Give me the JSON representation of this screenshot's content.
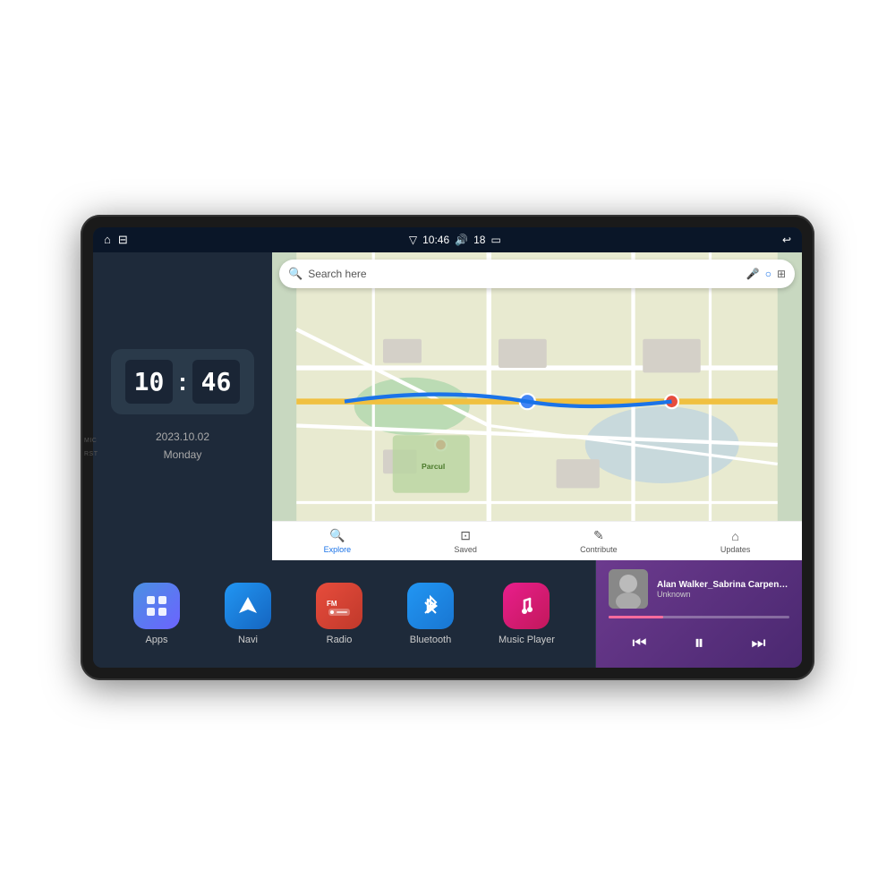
{
  "device": {
    "side_labels": [
      "MIC",
      "RST"
    ]
  },
  "status_bar": {
    "wifi_icon": "▽",
    "time": "10:46",
    "volume_icon": "🔊",
    "battery_num": "18",
    "battery_icon": "▭",
    "back_icon": "↩",
    "nav_home": "⌂",
    "nav_map": "⊟"
  },
  "clock": {
    "hour": "10",
    "minute": "46",
    "date": "2023.10.02",
    "day": "Monday"
  },
  "map": {
    "search_placeholder": "Search here",
    "tabs": [
      {
        "label": "Explore",
        "icon": "🔍",
        "active": true
      },
      {
        "label": "Saved",
        "icon": "⊡",
        "active": false
      },
      {
        "label": "Contribute",
        "icon": "⊞",
        "active": false
      },
      {
        "label": "Updates",
        "icon": "⌂",
        "active": false
      }
    ]
  },
  "apps": [
    {
      "id": "apps",
      "label": "Apps",
      "icon": "⊞",
      "bg_class": "apps-bg"
    },
    {
      "id": "navi",
      "label": "Navi",
      "icon": "▷",
      "bg_class": "navi-bg"
    },
    {
      "id": "radio",
      "label": "Radio",
      "icon": "FM",
      "bg_class": "radio-bg"
    },
    {
      "id": "bluetooth",
      "label": "Bluetooth",
      "icon": "✦",
      "bg_class": "bt-bg"
    },
    {
      "id": "music",
      "label": "Music Player",
      "icon": "♪",
      "bg_class": "music-bg"
    }
  ],
  "music_player": {
    "title": "Alan Walker_Sabrina Carpenter_F...",
    "artist": "Unknown",
    "progress": 30,
    "prev_label": "⏮",
    "play_label": "⏸",
    "next_label": "⏭"
  }
}
